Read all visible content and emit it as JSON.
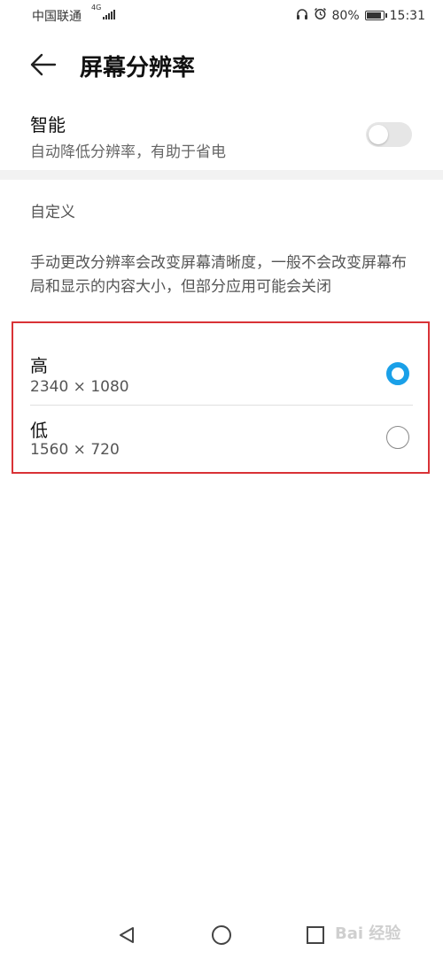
{
  "status_bar": {
    "carrier": "中国联通",
    "network": "4G",
    "battery": "80%",
    "time": "15:31",
    "icons": [
      "headset-icon",
      "alarm-icon",
      "battery-icon"
    ]
  },
  "header": {
    "title": "屏幕分辨率",
    "back_icon": "arrow-left-icon"
  },
  "smart": {
    "label": "智能",
    "description": "自动降低分辨率，有助于省电",
    "toggle_on": false
  },
  "custom": {
    "section_label": "自定义",
    "description": "手动更改分辨率会改变屏幕清晰度，一般不会改变屏幕布局和显示的内容大小，但部分应用可能会关闭"
  },
  "options": [
    {
      "label": "高",
      "resolution": "2340 × 1080",
      "selected": true
    },
    {
      "label": "低",
      "resolution": "1560 × 720",
      "selected": false
    }
  ],
  "colors": {
    "accent": "#1aa0e8",
    "highlight_border": "#d93236"
  },
  "watermark": "Bai 经验"
}
